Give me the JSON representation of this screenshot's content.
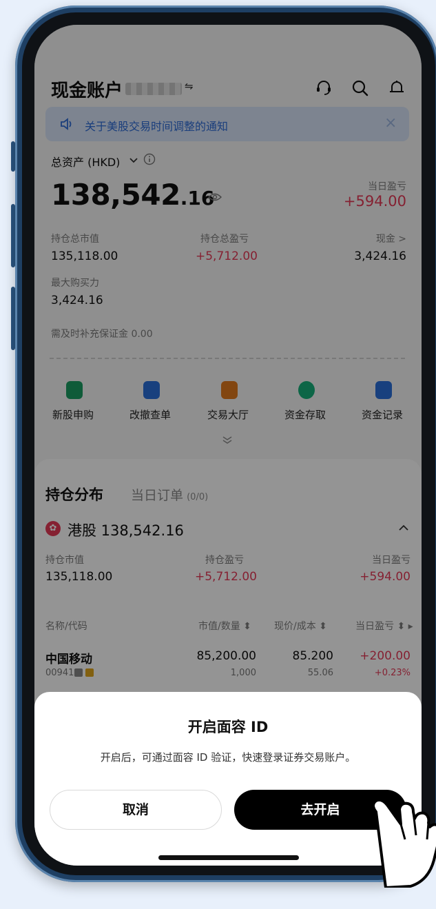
{
  "header": {
    "title": "现金账户",
    "switch_glyph": "⇋"
  },
  "notice": {
    "text": "关于美股交易时间调整的通知"
  },
  "assets": {
    "label": "总资产 (HKD)",
    "total_int": "138,542",
    "total_dec": ".16",
    "day_pl_label": "当日盈亏",
    "day_pl_value": "+594.00"
  },
  "stats": {
    "market_value_label": "持仓总市值",
    "market_value": "135,118.00",
    "pl_label": "持仓总盈亏",
    "pl_value": "+5,712.00",
    "cash_label": "现金 >",
    "cash_value": "3,424.16",
    "buying_power_label": "最大购买力",
    "buying_power_value": "3,424.16",
    "margin_call": "需及时补充保证金 0.00"
  },
  "quick_actions": [
    {
      "label": "新股申购",
      "icon": "ipo-bag-icon",
      "color": "#1a9e62"
    },
    {
      "label": "改撤查单",
      "icon": "order-list-icon",
      "color": "#2a6fd9"
    },
    {
      "label": "交易大厅",
      "icon": "trading-hall-icon",
      "color": "#e0791c"
    },
    {
      "label": "资金存取",
      "icon": "deposit-icon",
      "color": "#17b07a"
    },
    {
      "label": "资金记录",
      "icon": "fund-record-icon",
      "color": "#2a6fd9"
    }
  ],
  "holdings": {
    "tab_active": "持仓分布",
    "tab_orders": "当日订单",
    "tab_orders_count": "(0/0)",
    "market": "港股 138,542.16",
    "mv_label": "持仓市值",
    "mv_value": "135,118.00",
    "pl_label": "持仓盈亏",
    "pl_value": "+5,712.00",
    "day_label": "当日盈亏",
    "day_value": "+594.00",
    "columns": [
      "名称/代码",
      "市值/数量 ⬍",
      "现价/成本 ⬍",
      "当日盈亏 ⬍ ▸"
    ],
    "rows": [
      {
        "name": "中国移动",
        "code": "00941",
        "mkt_value": "85,200.00",
        "qty": "1,000",
        "price": "85.200",
        "cost": "55.06",
        "day_pl": "+200.00",
        "day_pl_pct": "+0.23%"
      }
    ]
  },
  "dialog": {
    "title": "开启面容 ID",
    "description": "开启后，可通过面容 ID 验证，快速登录证券交易账户。",
    "cancel_label": "取消",
    "confirm_label": "去开启"
  },
  "colors": {
    "accent_red": "#e53957",
    "notice_blue": "#2e6bd6",
    "primary_button": "#000000"
  }
}
